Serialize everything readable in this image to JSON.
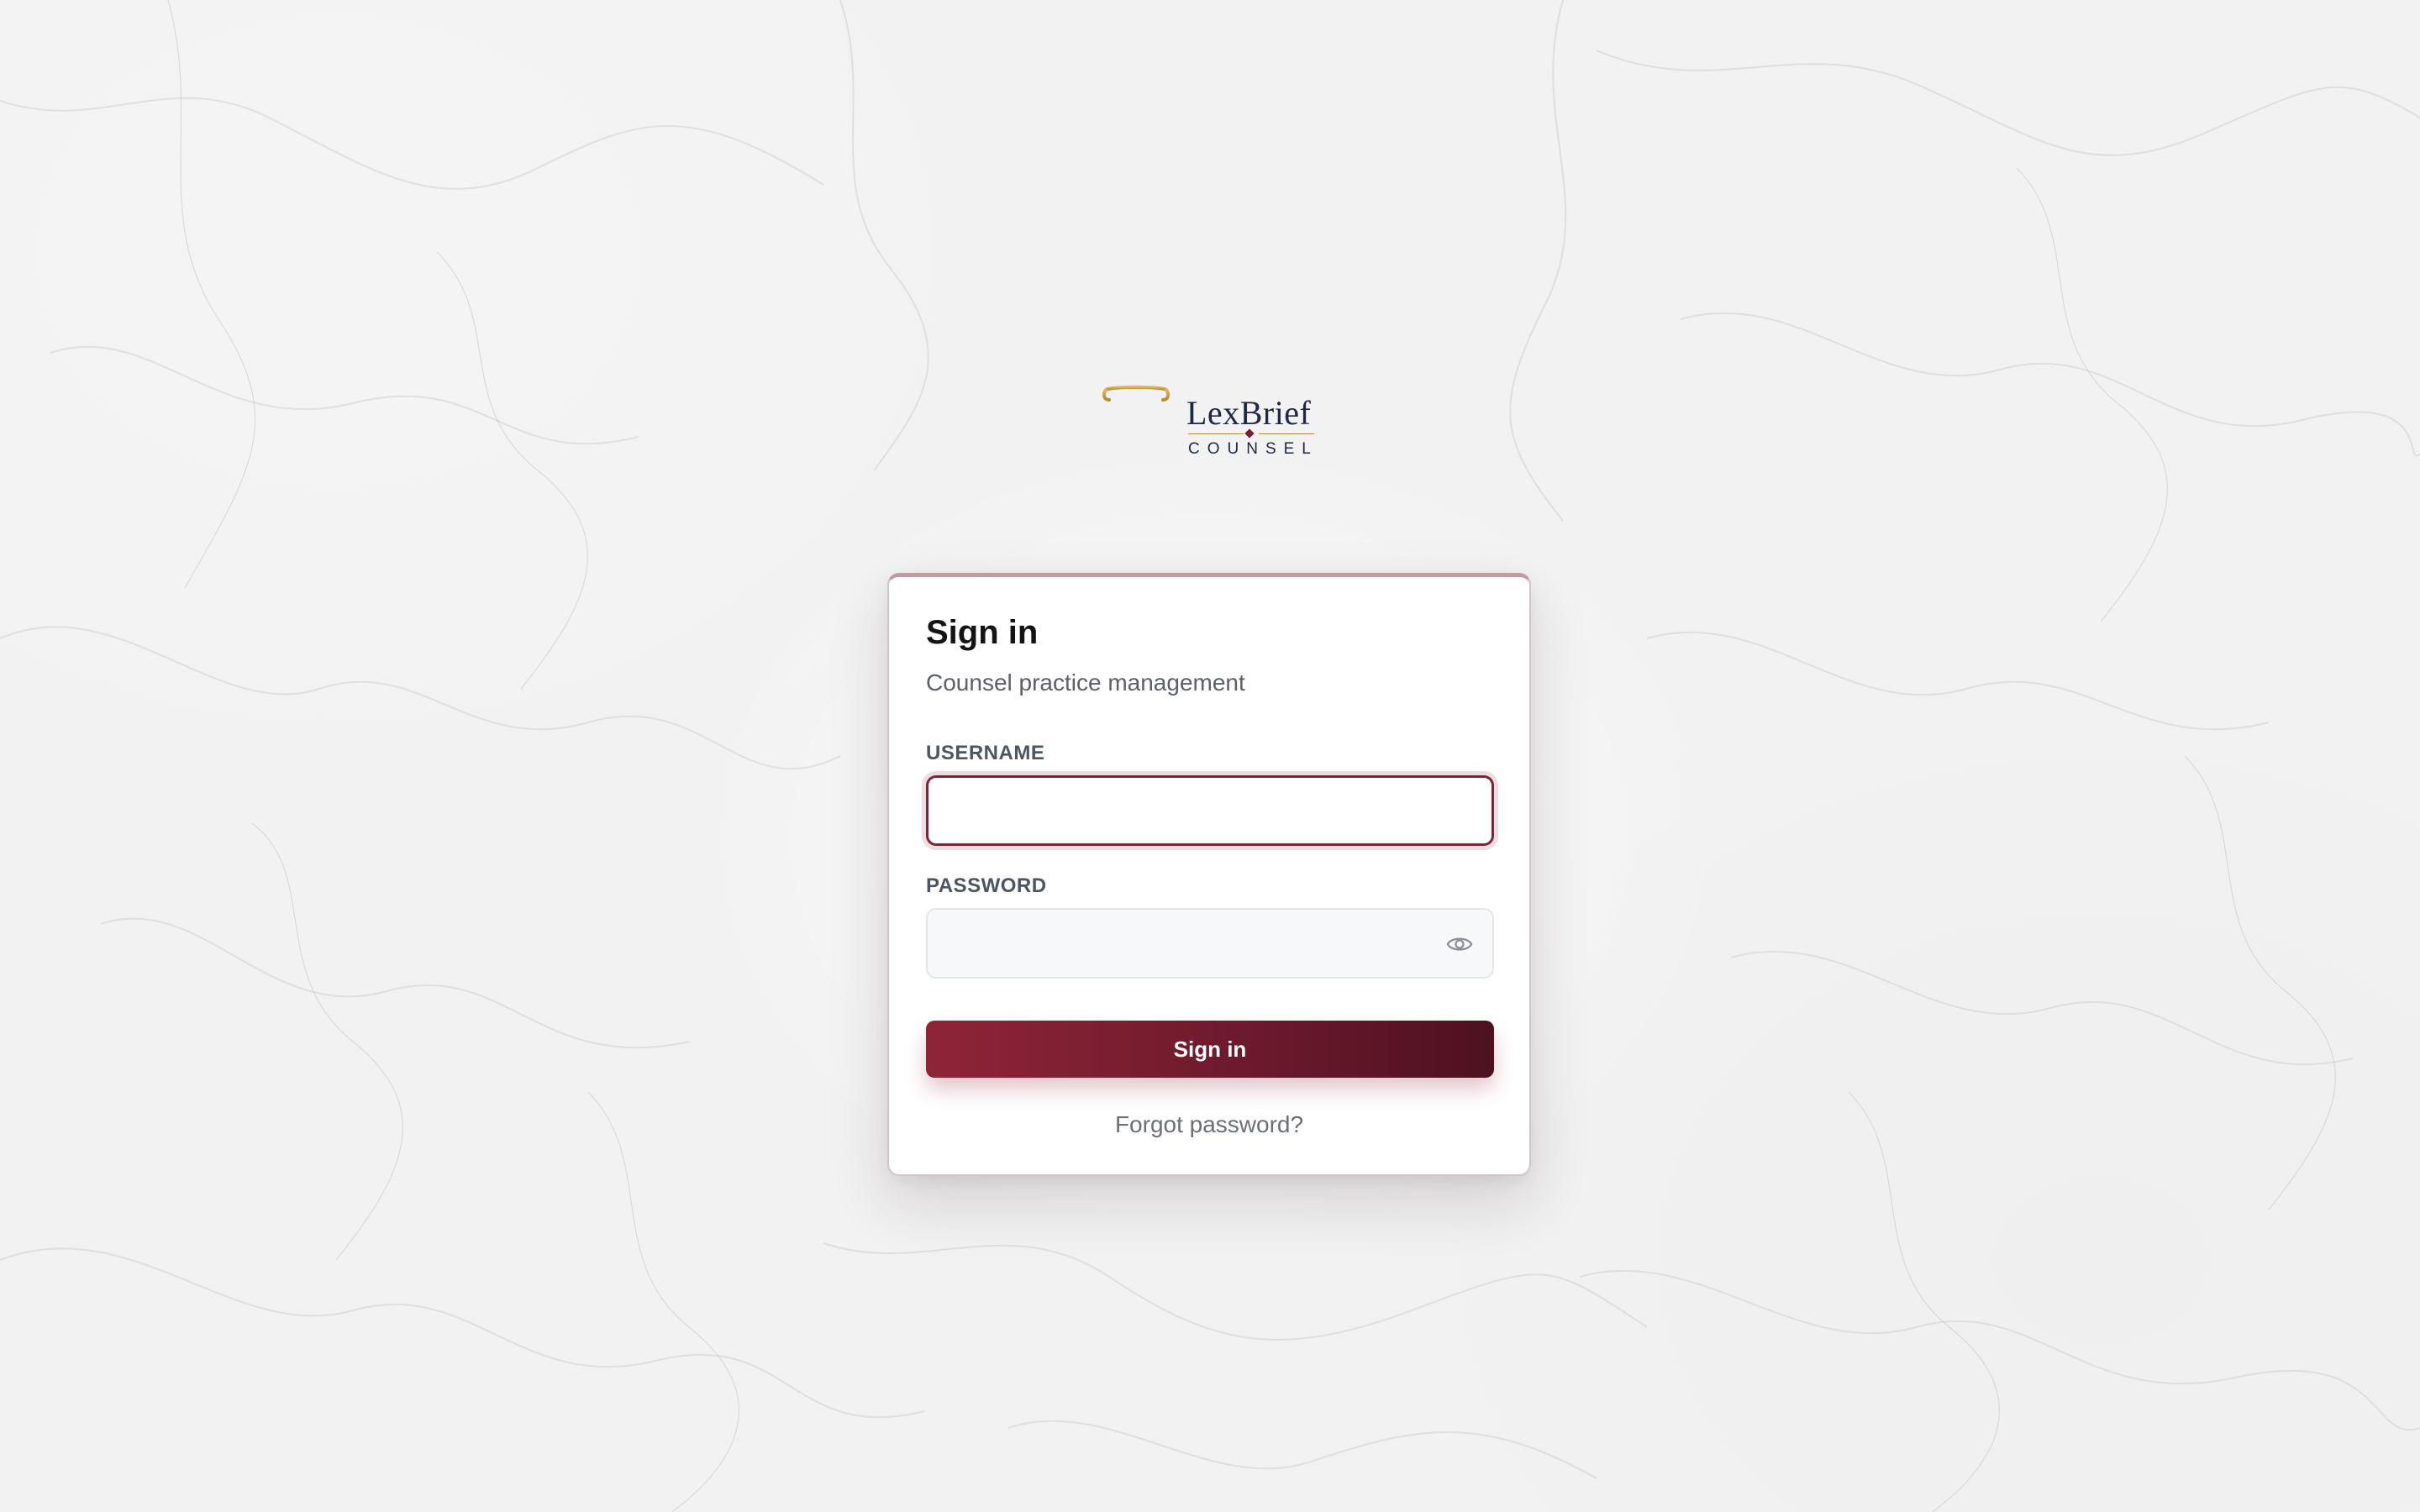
{
  "brand": {
    "name": "LexBrief",
    "tagline": "COUNSEL",
    "icon": "pillar-icon"
  },
  "signin": {
    "title": "Sign in",
    "subtitle": "Counsel practice management",
    "username_label": "USERNAME",
    "username_value": "",
    "username_placeholder": "",
    "password_label": "PASSWORD",
    "password_value": "",
    "password_placeholder": "",
    "submit_label": "Sign in",
    "forgot_label": "Forgot password?"
  },
  "colors": {
    "accent": "#7b2636",
    "brand_gold": "#c9992f",
    "brand_navy": "#1f2744"
  },
  "icons": {
    "toggle_password": "eye-icon"
  }
}
